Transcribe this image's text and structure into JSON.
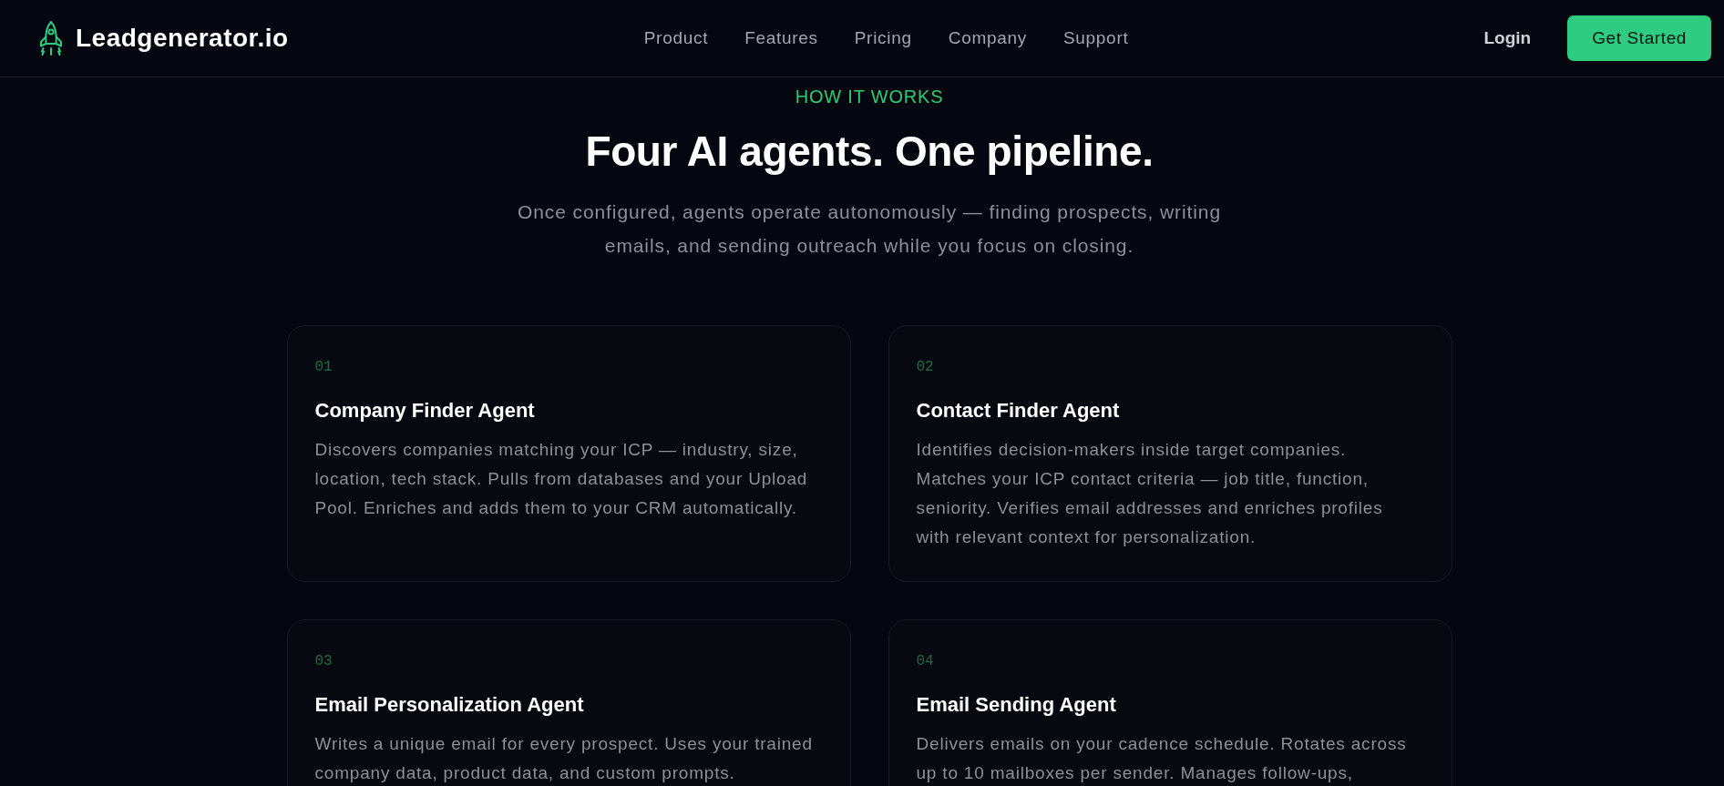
{
  "header": {
    "brand": "Leadgenerator.io",
    "nav": [
      {
        "label": "Product"
      },
      {
        "label": "Features"
      },
      {
        "label": "Pricing"
      },
      {
        "label": "Company"
      },
      {
        "label": "Support"
      }
    ],
    "login": "Login",
    "cta": "Get Started"
  },
  "section": {
    "eyebrow": "HOW IT WORKS",
    "title": "Four AI agents. One pipeline.",
    "subtitle": "Once configured, agents operate autonomously — finding prospects, writing emails, and sending outreach while you focus on closing."
  },
  "agents": [
    {
      "number": "01",
      "title": "Company Finder Agent",
      "description": "Discovers companies matching your ICP — industry, size, location, tech stack. Pulls from databases and your Upload Pool. Enriches and adds them to your CRM automatically."
    },
    {
      "number": "02",
      "title": "Contact Finder Agent",
      "description": "Identifies decision-makers inside target companies. Matches your ICP contact criteria — job title, function, seniority. Verifies email addresses and enriches profiles with relevant context for personalization."
    },
    {
      "number": "03",
      "title": "Email Personalization Agent",
      "description": "Writes a unique email for every prospect. Uses your trained company data, product data, and custom prompts."
    },
    {
      "number": "04",
      "title": "Email Sending Agent",
      "description": "Delivers emails on your cadence schedule. Rotates across up to 10 mailboxes per sender. Manages follow-ups,"
    }
  ]
}
